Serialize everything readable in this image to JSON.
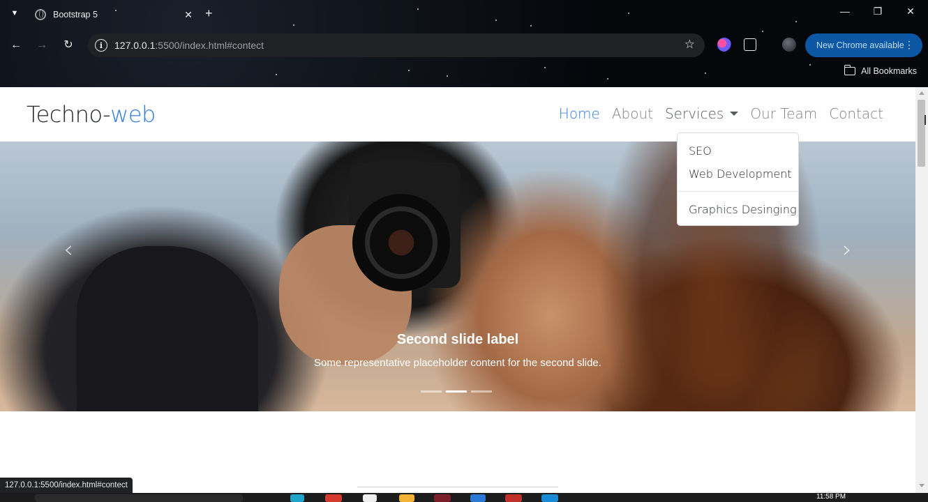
{
  "browser": {
    "tab_title": "Bootstrap 5",
    "url_host": "127.0.0.1",
    "url_rest": ":5500/index.html#contect",
    "update_label": "New Chrome available",
    "all_bookmarks_label": "All Bookmarks",
    "status_url": "127.0.0.1:5500/index.html#contect"
  },
  "site": {
    "brand_main": "Techno-",
    "brand_accent": "web",
    "brand_accent_color": "#2f7be0",
    "nav": [
      {
        "label": "Home",
        "active": true
      },
      {
        "label": "About",
        "active": false
      },
      {
        "label": "Services",
        "active": false,
        "dropdown": true
      },
      {
        "label": "Our Team",
        "active": false
      },
      {
        "label": "Contact",
        "active": false
      }
    ],
    "dropdown": {
      "items": [
        "SEO",
        "Web Development",
        "Graphics Desinging"
      ]
    },
    "carousel": {
      "title": "Second slide label",
      "text": "Some representative placeholder content for the second slide.",
      "slides_total": 3,
      "active_slide": 2,
      "prev_icon": "chevron-left-icon",
      "next_icon": "chevron-right-icon"
    }
  },
  "taskbar": {
    "clock": "11:58 PM"
  }
}
